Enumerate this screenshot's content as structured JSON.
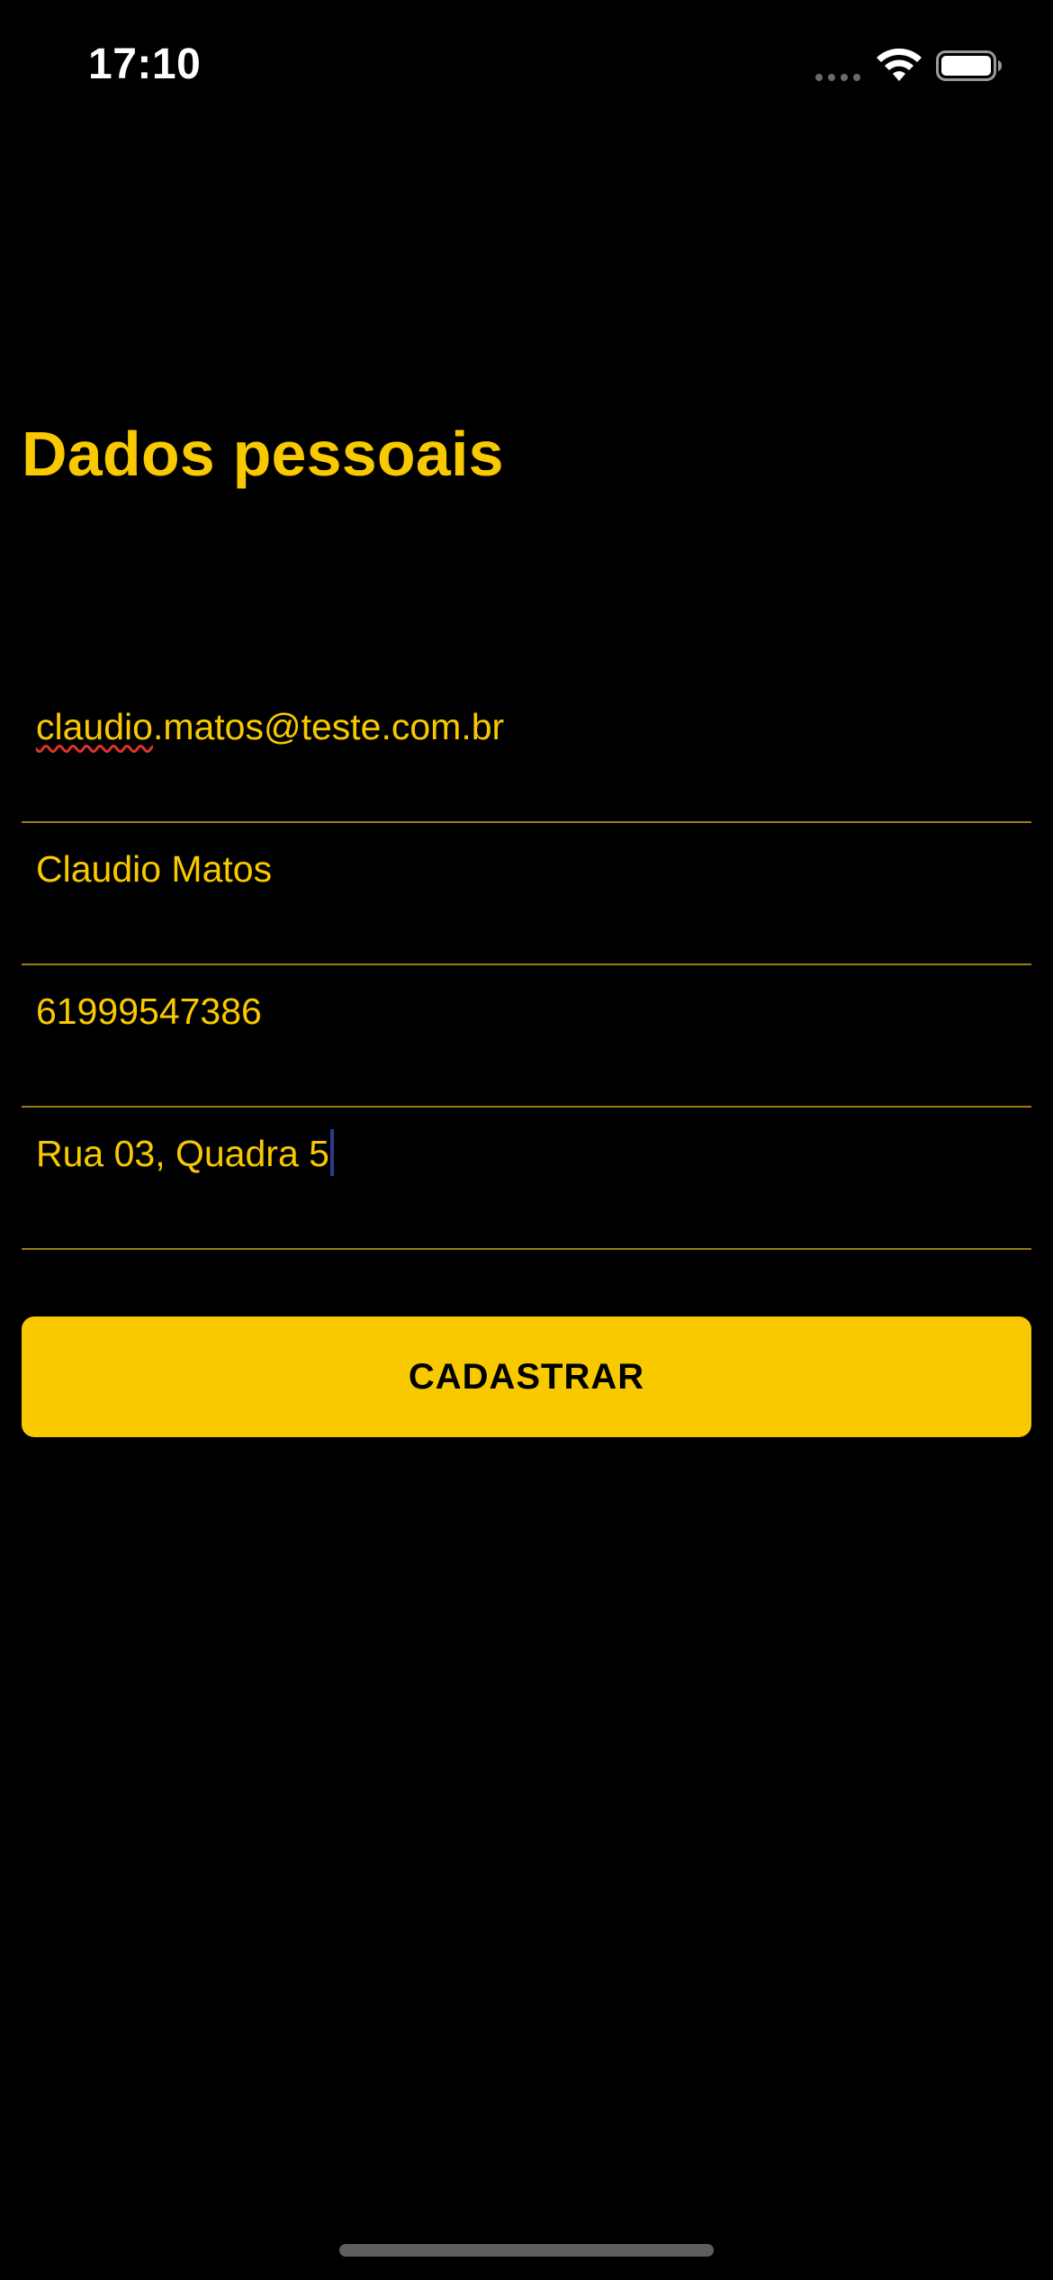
{
  "status_bar": {
    "time": "17:10",
    "icons": [
      "signal-dots-icon",
      "wifi-icon",
      "battery-icon"
    ],
    "battery_level": 1.0
  },
  "page": {
    "title": "Dados pessoais"
  },
  "form": {
    "email": {
      "value_underlined": "claudio",
      "value_rest": ".matos@teste.com.br"
    },
    "name": {
      "value": "Claudio Matos"
    },
    "phone": {
      "value": "61999547386"
    },
    "address": {
      "value": "Rua 03, Quadra 5"
    },
    "submit_label": "CADASTRAR"
  },
  "colors": {
    "background": "#000000",
    "accent": "#F9C900",
    "divider": "#9a7d12",
    "button_text": "#000000",
    "spellcheck": "#e0332b"
  }
}
